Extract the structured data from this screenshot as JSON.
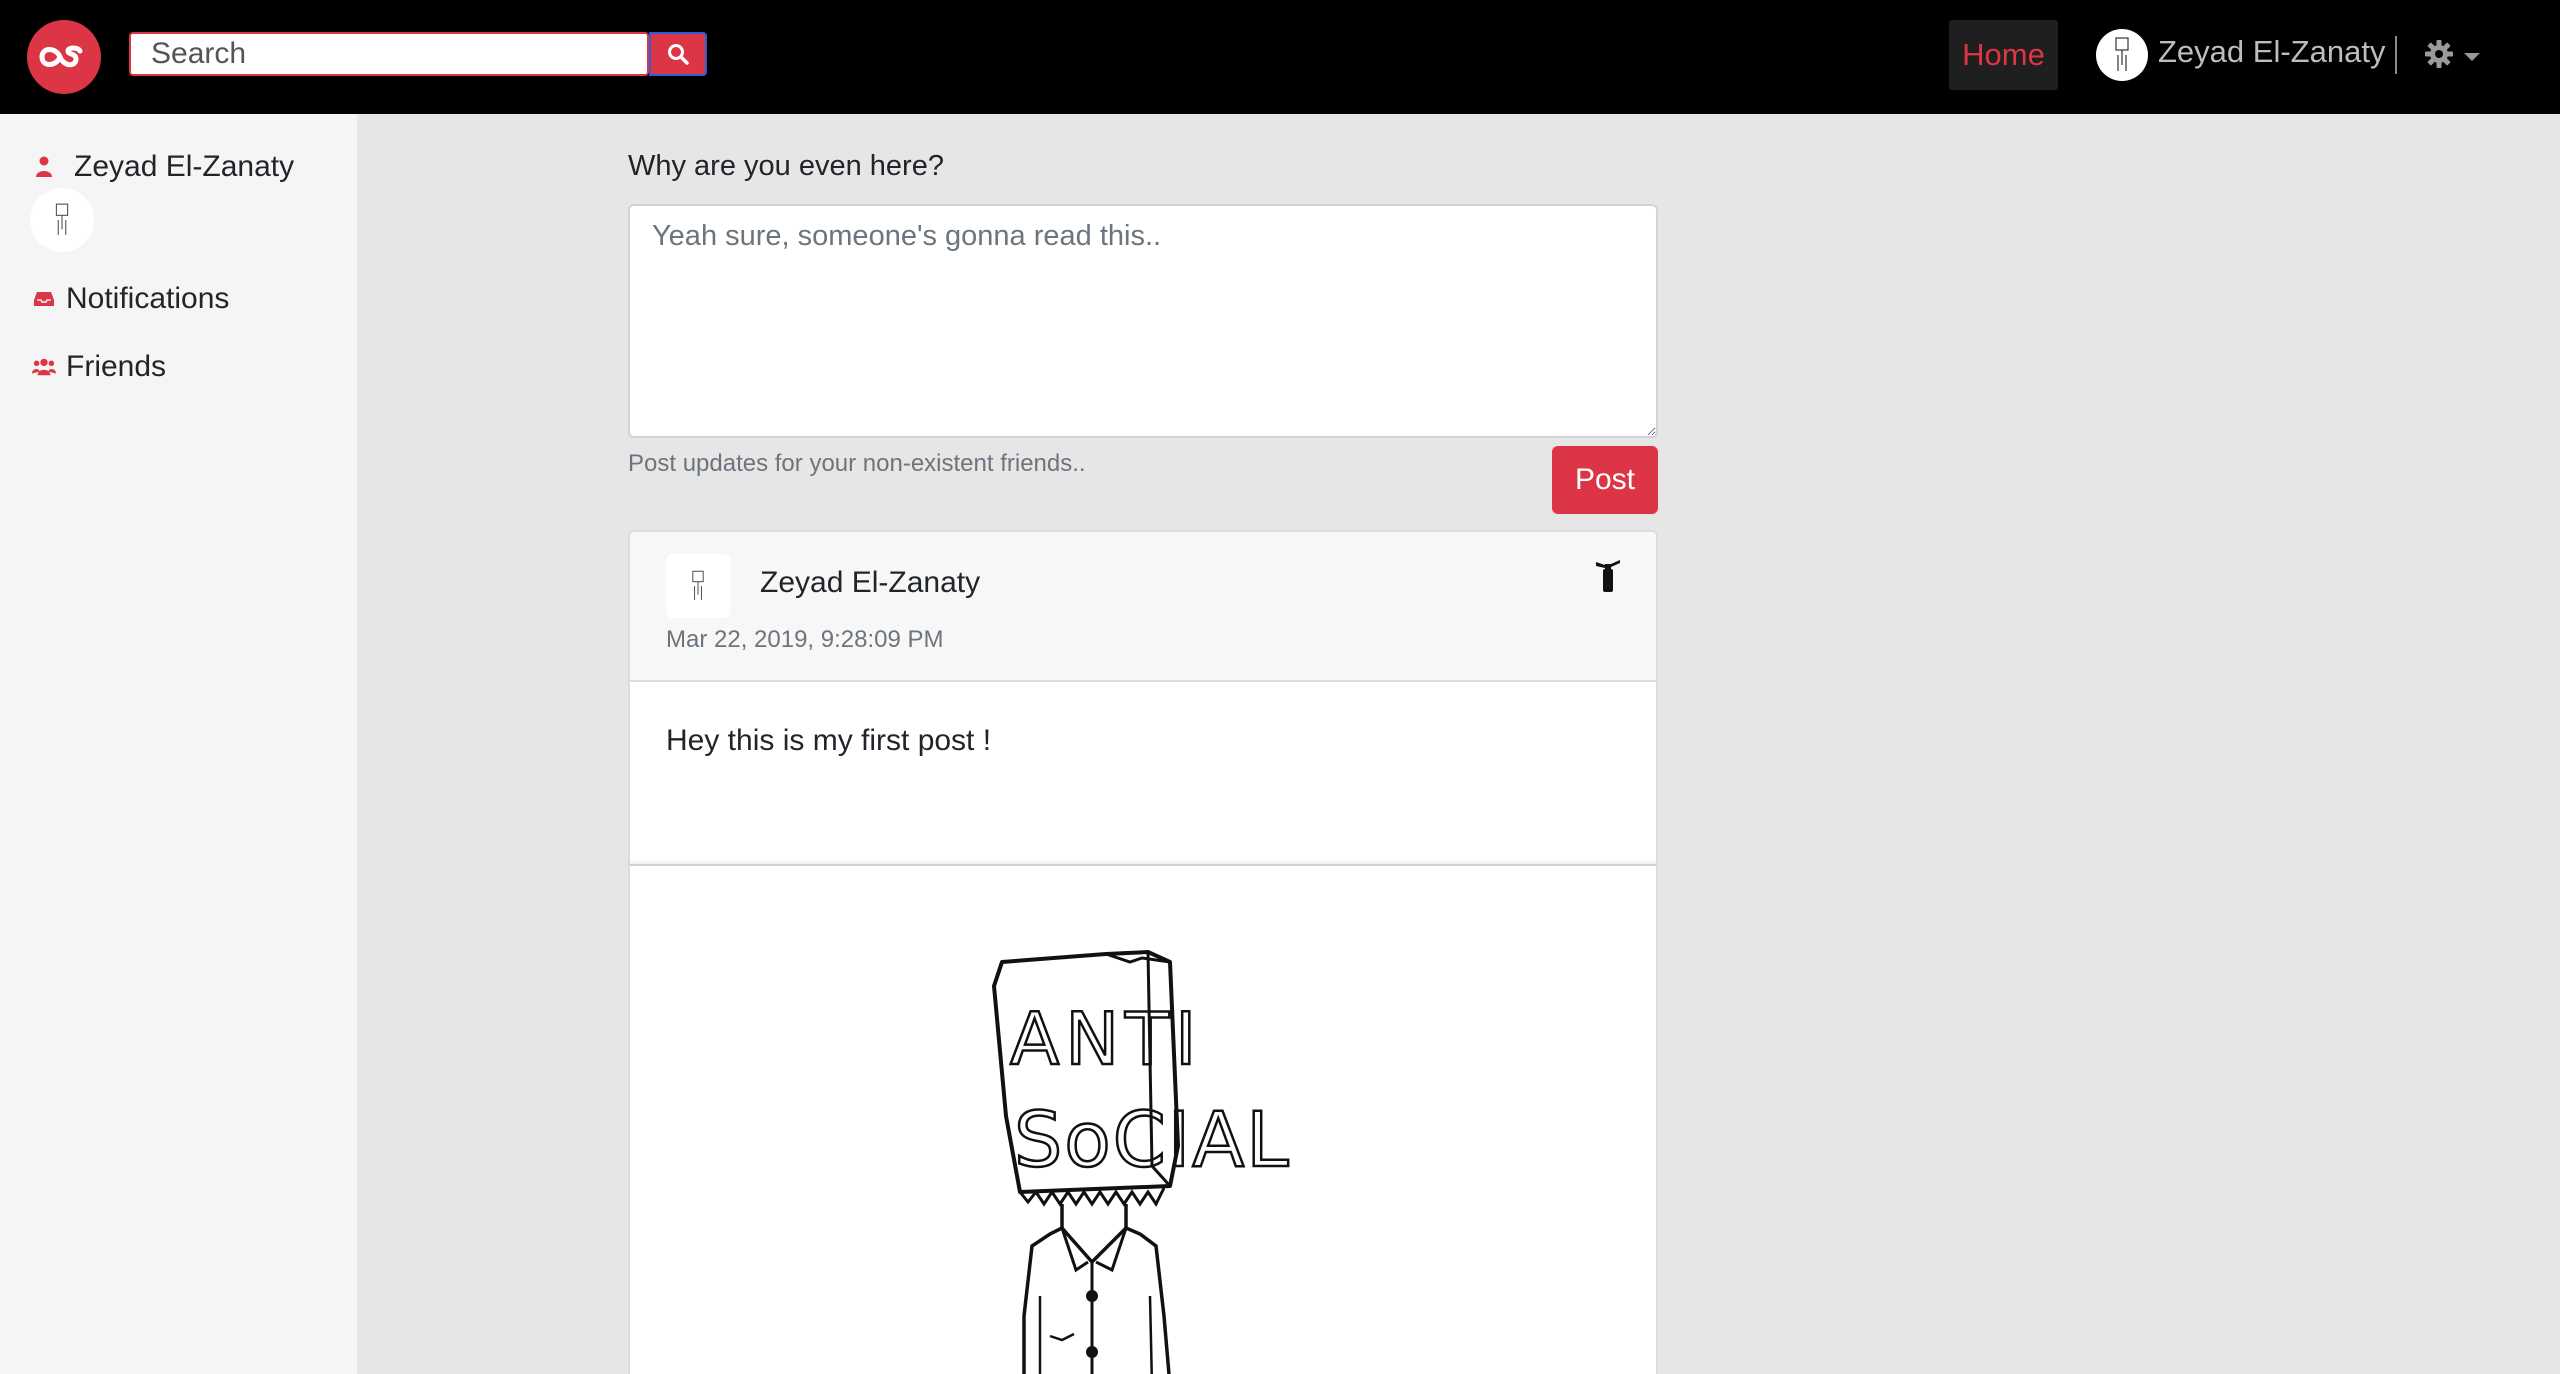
{
  "navbar": {
    "search_placeholder": "Search",
    "home_label": "Home",
    "user_name": "Zeyad El-Zanaty",
    "icons": [
      "lastfm-logo-icon",
      "search-icon",
      "avatar",
      "gear-icon",
      "caret-down-icon"
    ]
  },
  "sidebar": {
    "profile_name": "Zeyad El-Zanaty",
    "items": [
      {
        "label": "Notifications",
        "icon": "inbox-icon"
      },
      {
        "label": "Friends",
        "icon": "users-icon"
      }
    ]
  },
  "composer": {
    "label": "Why are you even here?",
    "placeholder": "Yeah sure, someone's gonna read this..",
    "help_text": "Post updates for your non-existent friends..",
    "submit_label": "Post"
  },
  "post": {
    "author": "Zeyad El-Zanaty",
    "timestamp": "Mar 22, 2019, 9:28:09 PM",
    "body": "Hey this is my first post !",
    "image_text": "ANTI SOCIAL"
  },
  "colors": {
    "accent": "#dc3545",
    "navbar_bg": "#000000",
    "page_bg": "#e6e6e6",
    "sidebar_bg": "#f5f5f5"
  }
}
